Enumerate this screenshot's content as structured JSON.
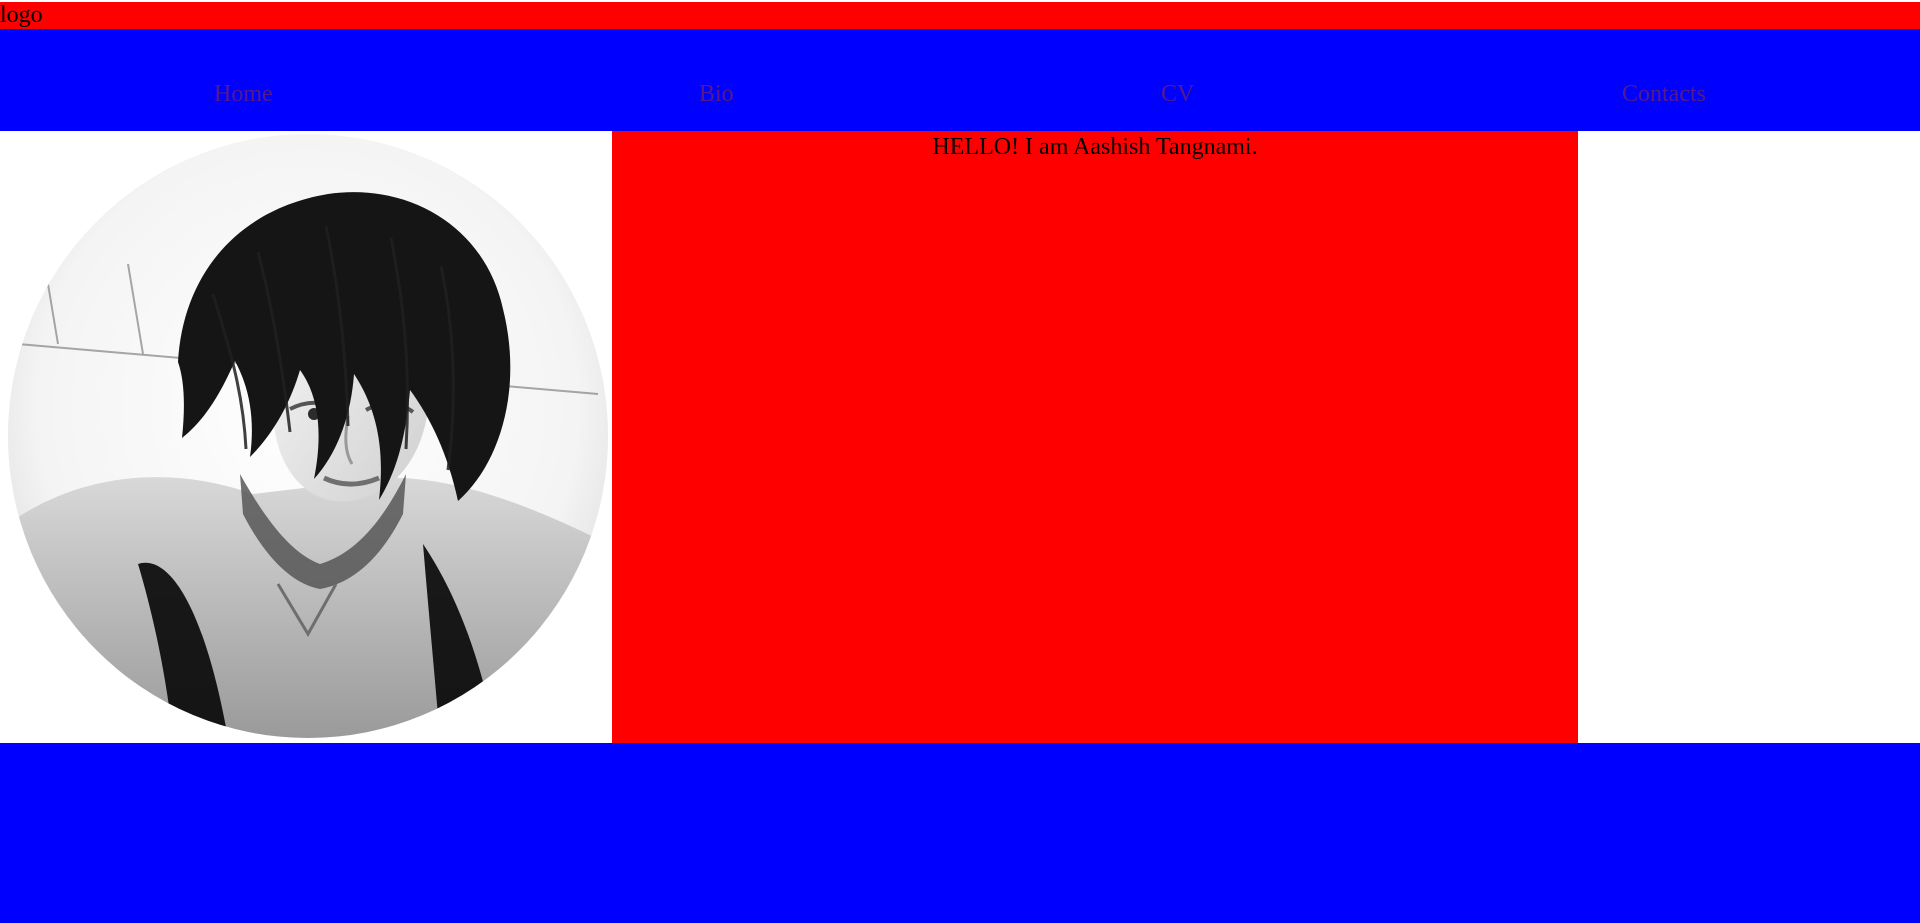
{
  "header": {
    "logo_text": "logo",
    "bar_color": "#ff0000"
  },
  "nav": {
    "background_color": "#0000ff",
    "link_color": "#551a8b",
    "items": [
      {
        "label": "Home"
      },
      {
        "label": "Bio"
      },
      {
        "label": "CV"
      },
      {
        "label": "Contacts"
      }
    ]
  },
  "main": {
    "portrait": {
      "icon": "profile-photo",
      "alt": "Aashish Tangnami portrait"
    },
    "hello_text": "HELLO! I am Aashish Tangnami.",
    "panel_color": "#ff0000"
  },
  "footer": {
    "background_color": "#0000ff"
  }
}
